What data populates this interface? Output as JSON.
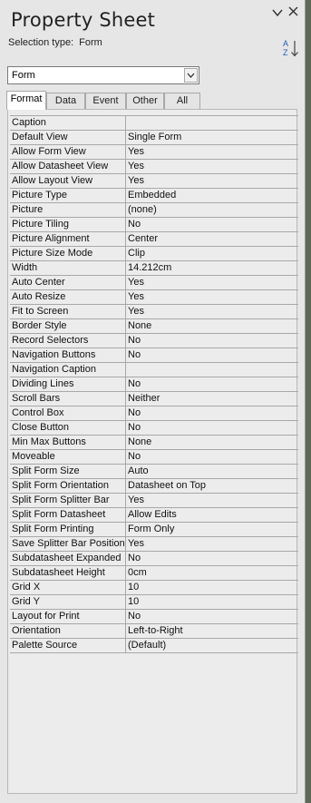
{
  "header": {
    "title": "Property Sheet",
    "selection_label": "Selection type:",
    "selection_value": "Form",
    "chevron_icon": "chevron-down-icon",
    "close_icon": "close-icon",
    "sort_icon": "sort-az-icon"
  },
  "object_selector": {
    "value": "Form"
  },
  "tabs": [
    {
      "label": "Format",
      "active": true
    },
    {
      "label": "Data",
      "active": false
    },
    {
      "label": "Event",
      "active": false
    },
    {
      "label": "Other",
      "active": false
    },
    {
      "label": "All",
      "active": false
    }
  ],
  "properties": [
    {
      "name": "Caption",
      "value": ""
    },
    {
      "name": "Default View",
      "value": "Single Form"
    },
    {
      "name": "Allow Form View",
      "value": "Yes"
    },
    {
      "name": "Allow Datasheet View",
      "value": "Yes"
    },
    {
      "name": "Allow Layout View",
      "value": "Yes"
    },
    {
      "name": "Picture Type",
      "value": "Embedded"
    },
    {
      "name": "Picture",
      "value": "(none)"
    },
    {
      "name": "Picture Tiling",
      "value": "No"
    },
    {
      "name": "Picture Alignment",
      "value": "Center"
    },
    {
      "name": "Picture Size Mode",
      "value": "Clip"
    },
    {
      "name": "Width",
      "value": "14.212cm"
    },
    {
      "name": "Auto Center",
      "value": "Yes"
    },
    {
      "name": "Auto Resize",
      "value": "Yes"
    },
    {
      "name": "Fit to Screen",
      "value": "Yes"
    },
    {
      "name": "Border Style",
      "value": "None"
    },
    {
      "name": "Record Selectors",
      "value": "No"
    },
    {
      "name": "Navigation Buttons",
      "value": "No"
    },
    {
      "name": "Navigation Caption",
      "value": ""
    },
    {
      "name": "Dividing Lines",
      "value": "No"
    },
    {
      "name": "Scroll Bars",
      "value": "Neither"
    },
    {
      "name": "Control Box",
      "value": "No"
    },
    {
      "name": "Close Button",
      "value": "No"
    },
    {
      "name": "Min Max Buttons",
      "value": "None"
    },
    {
      "name": "Moveable",
      "value": "No"
    },
    {
      "name": "Split Form Size",
      "value": "Auto"
    },
    {
      "name": "Split Form Orientation",
      "value": "Datasheet on Top"
    },
    {
      "name": "Split Form Splitter Bar",
      "value": "Yes"
    },
    {
      "name": "Split Form Datasheet",
      "value": "Allow Edits"
    },
    {
      "name": "Split Form Printing",
      "value": "Form Only"
    },
    {
      "name": "Save Splitter Bar Position",
      "value": "Yes"
    },
    {
      "name": "Subdatasheet Expanded",
      "value": "No"
    },
    {
      "name": "Subdatasheet Height",
      "value": "0cm"
    },
    {
      "name": "Grid X",
      "value": "10"
    },
    {
      "name": "Grid Y",
      "value": "10"
    },
    {
      "name": "Layout for Print",
      "value": "No"
    },
    {
      "name": "Orientation",
      "value": "Left-to-Right"
    },
    {
      "name": "Palette Source",
      "value": "(Default)"
    }
  ]
}
